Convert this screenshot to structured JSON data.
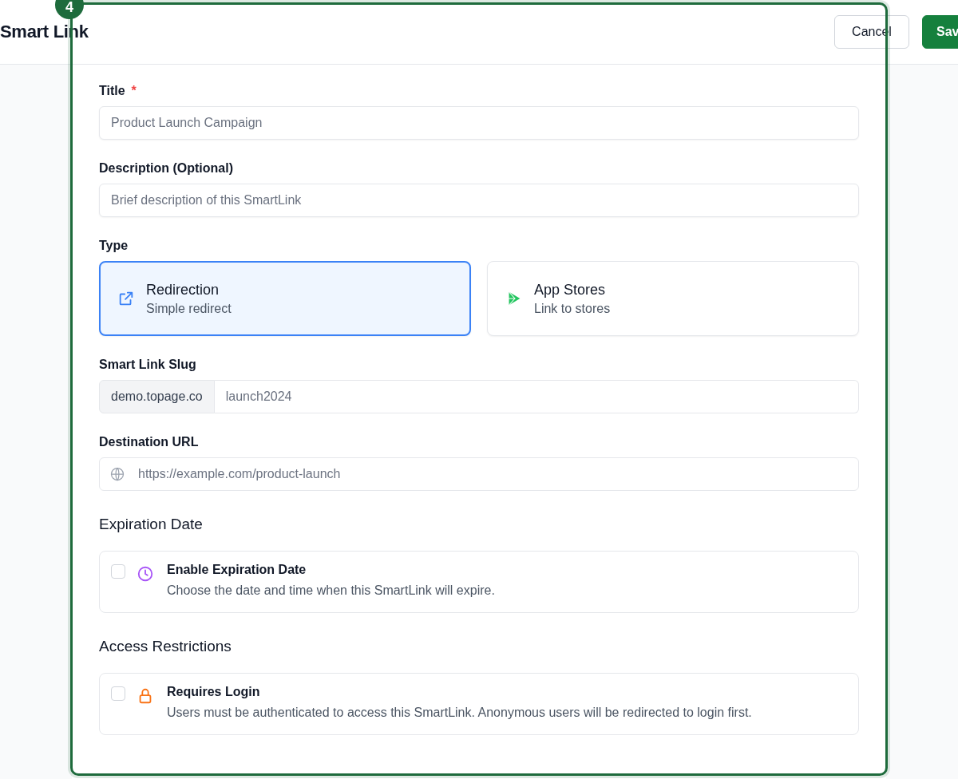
{
  "header": {
    "title": "Smart Link",
    "buttons": [
      {
        "label": "Cancel",
        "kind": "secondary"
      },
      {
        "label": "Sav",
        "kind": "primary"
      }
    ]
  },
  "step_badge": "4",
  "fields": [
    {
      "label": "Title",
      "required": true,
      "required_mark": "*",
      "placeholder": "Product Launch Campaign"
    },
    {
      "label": "Description (Optional)",
      "placeholder": "Brief description of this SmartLink"
    }
  ],
  "type": {
    "label": "Type",
    "options": [
      {
        "title": "Redirection",
        "subtitle": "Simple redirect",
        "kind": "external",
        "selected": true
      },
      {
        "title": "App Stores",
        "subtitle": "Link to stores",
        "kind": "play",
        "selected": false
      }
    ]
  },
  "slug": {
    "label": "Smart Link Slug",
    "prefix": "demo.topage.co",
    "placeholder": "launch2024"
  },
  "destination": {
    "label": "Destination URL",
    "placeholder": "https://example.com/product-launch"
  },
  "sections": [
    {
      "heading": "Expiration Date",
      "option": {
        "title": "Enable Expiration Date",
        "description": "Choose the date and time when this SmartLink will expire.",
        "kind": "clock",
        "checked": false
      }
    },
    {
      "heading": "Access Restrictions",
      "option": {
        "title": "Requires Login",
        "description": "Users must be authenticated to access this SmartLink. Anonymous users will be redirected to login first.",
        "kind": "lock",
        "checked": false
      }
    }
  ]
}
